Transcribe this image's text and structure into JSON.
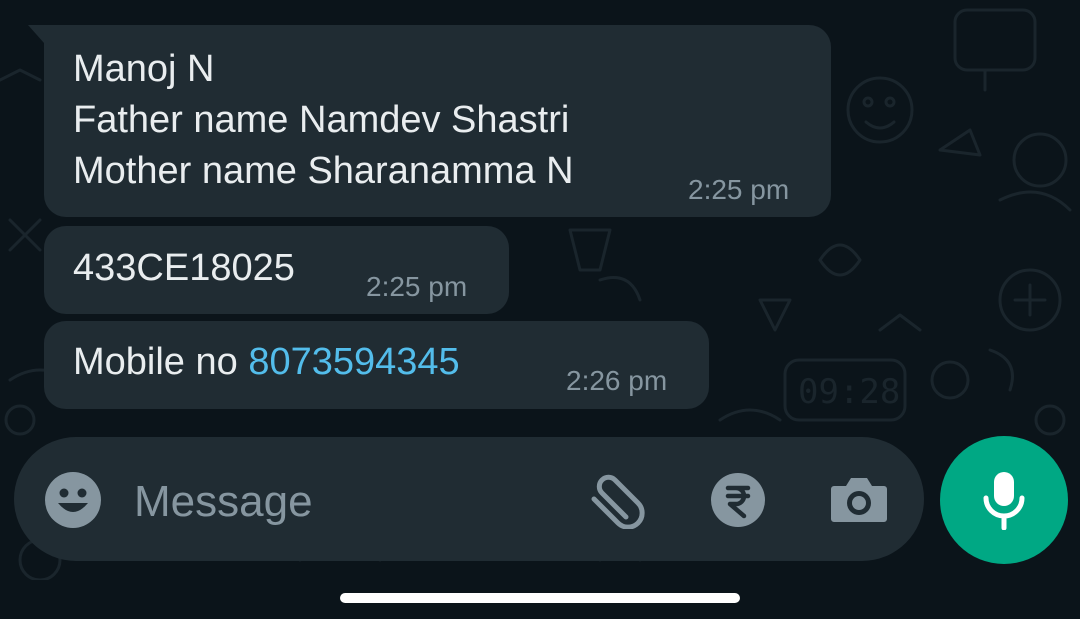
{
  "messages": [
    {
      "lines": [
        "Manoj N",
        "Father name Namdev Shastri",
        "Mother name Sharanamma N"
      ],
      "time": "2:25 pm"
    },
    {
      "lines": [
        "433CE18025"
      ],
      "time": "2:25 pm"
    },
    {
      "prefix": "Mobile no ",
      "link": "8073594345",
      "time": "2:26 pm"
    }
  ],
  "composer": {
    "placeholder": "Message",
    "icons": [
      "emoji-icon",
      "attach-icon",
      "payment-rupee-icon",
      "camera-icon",
      "mic-icon"
    ]
  },
  "wallpaper_clock": "09:28",
  "colors": {
    "background": "#0b141a",
    "bubble": "#202c33",
    "text": "#e9edef",
    "meta": "#8696a0",
    "link": "#53bdeb",
    "accent": "#00a884"
  }
}
